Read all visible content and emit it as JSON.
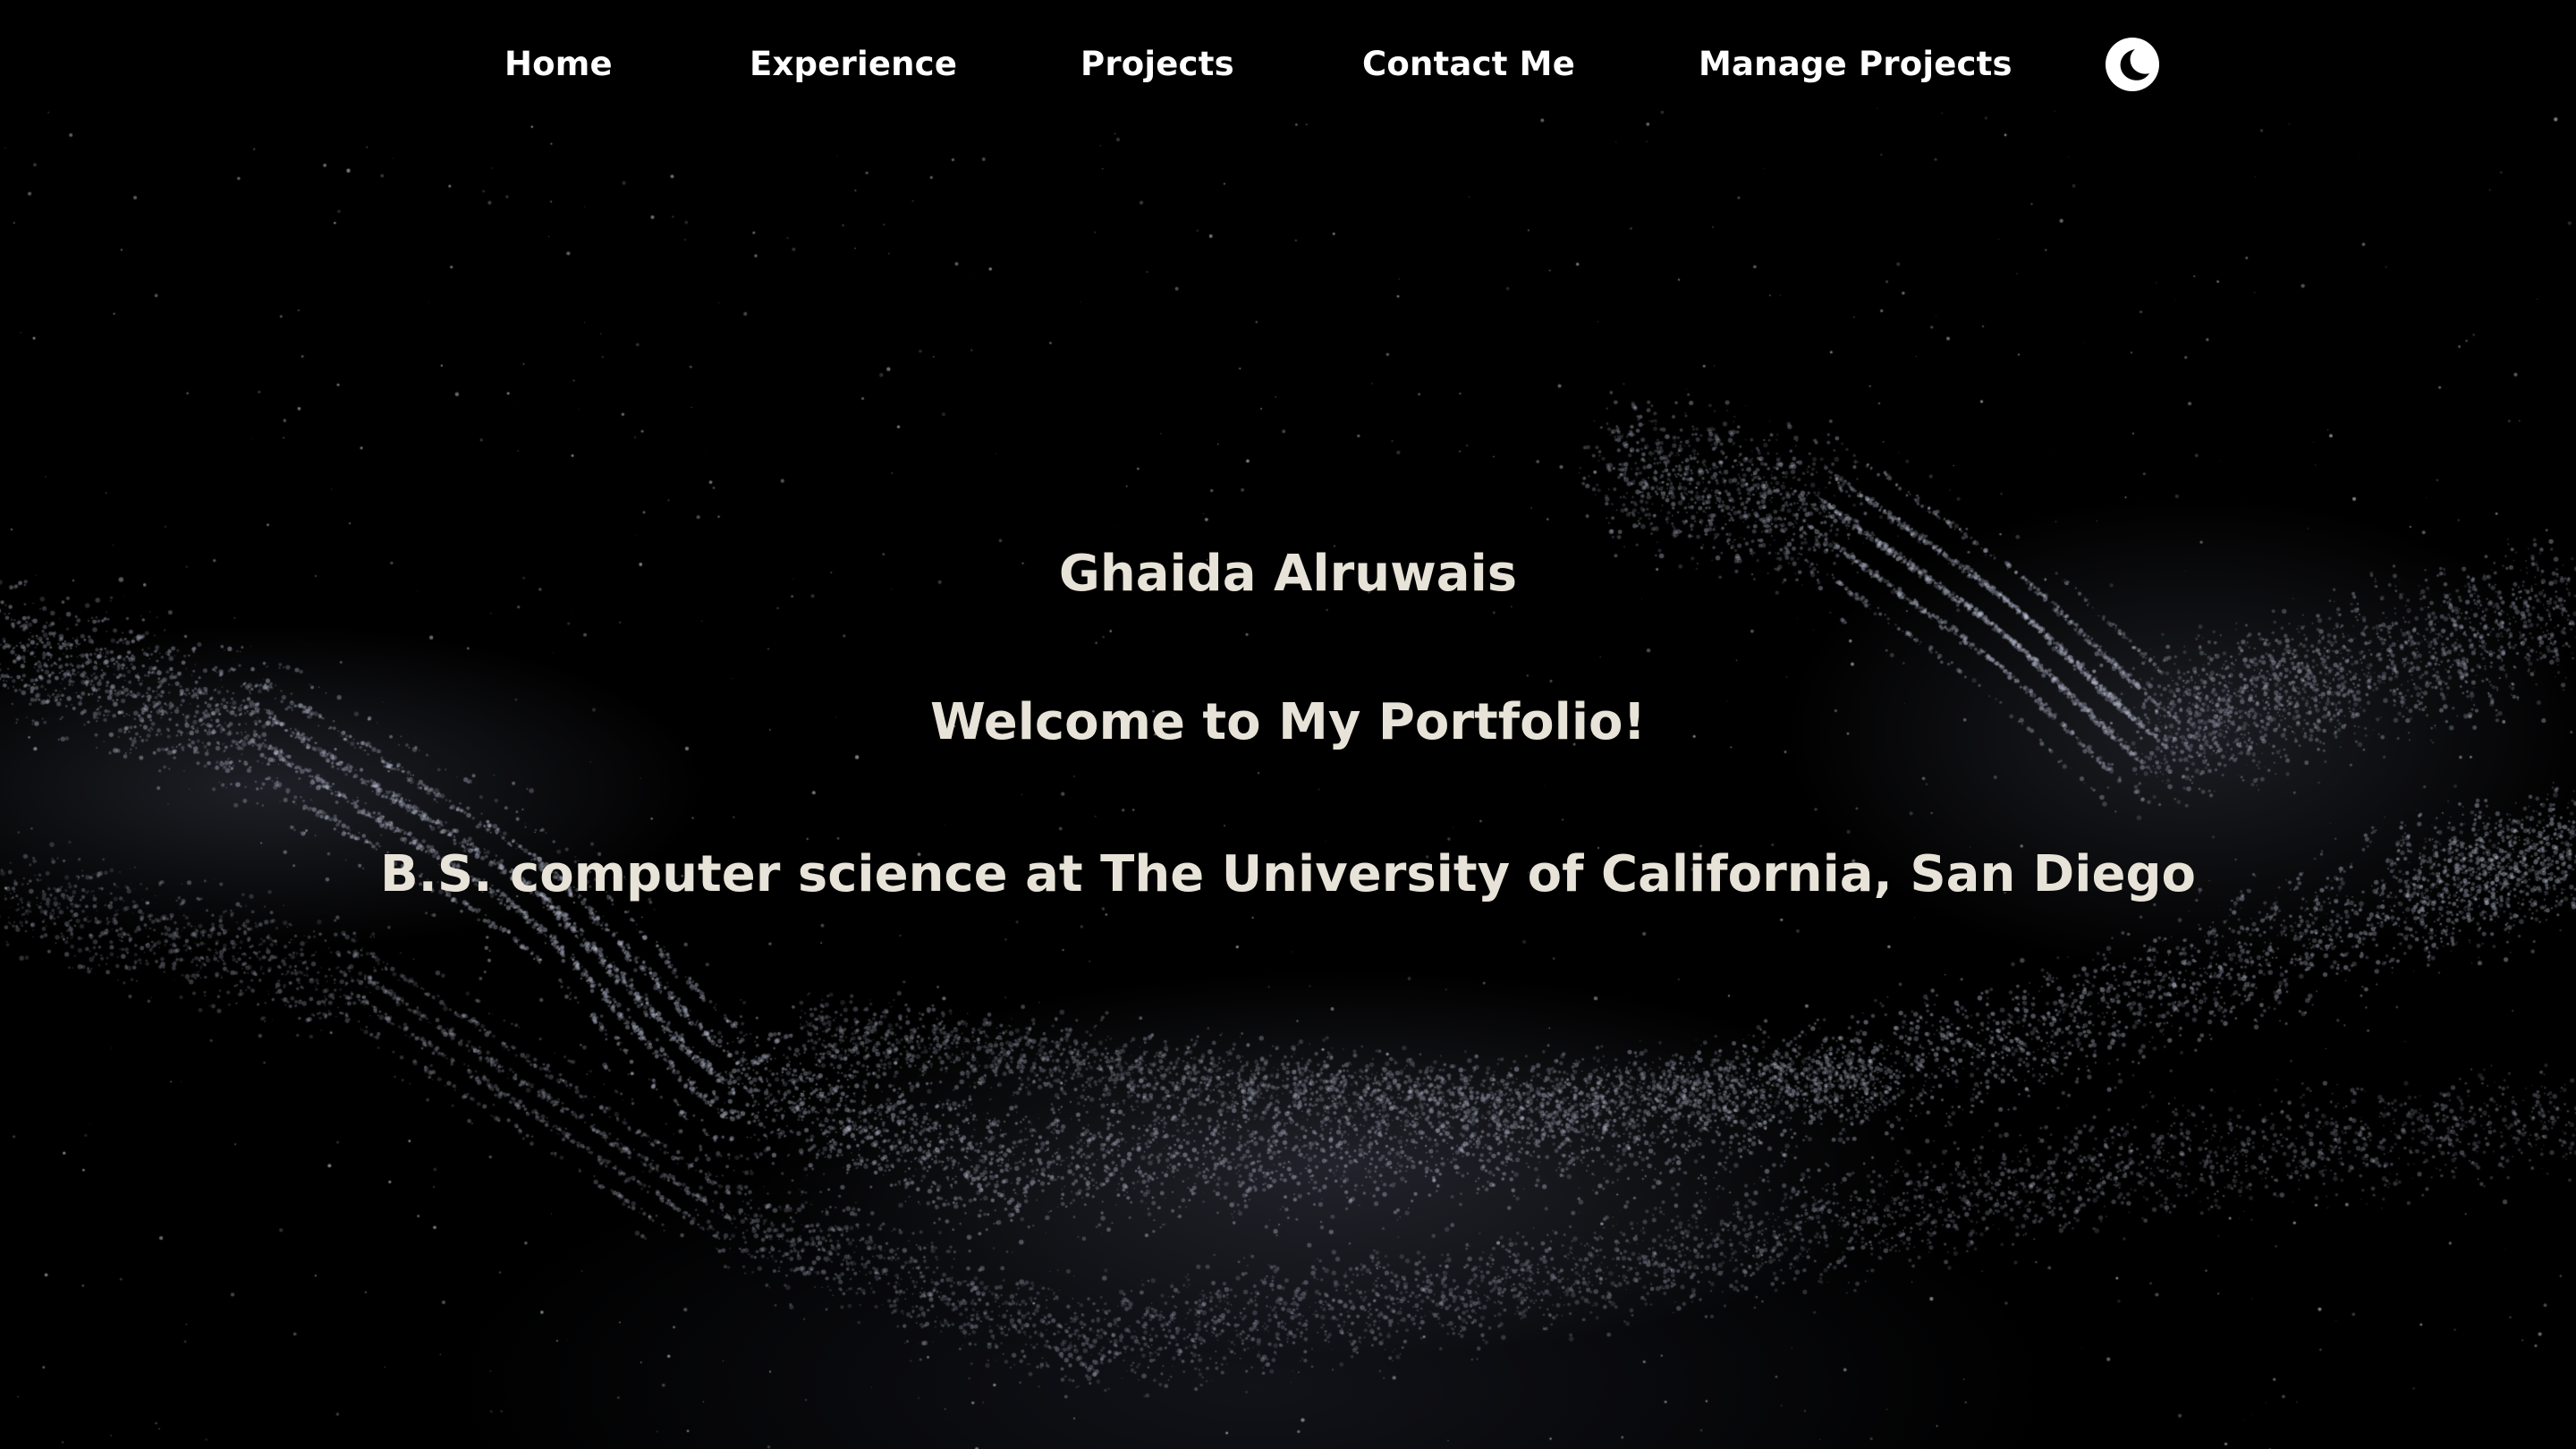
{
  "nav": {
    "items": [
      {
        "label": "Home"
      },
      {
        "label": "Experience"
      },
      {
        "label": "Projects"
      },
      {
        "label": "Contact Me"
      },
      {
        "label": "Manage Projects"
      }
    ],
    "theme_toggle_icon": "moon-icon"
  },
  "hero": {
    "name": "Ghaida Alruwais",
    "welcome": "Welcome to My Portfolio!",
    "degree": "B.S. computer science at The University of California, San Diego"
  },
  "colors": {
    "background": "#000000",
    "nav_text": "#ffffff",
    "hero_text": "#e8e3d8",
    "toggle_background": "#ffffff"
  }
}
